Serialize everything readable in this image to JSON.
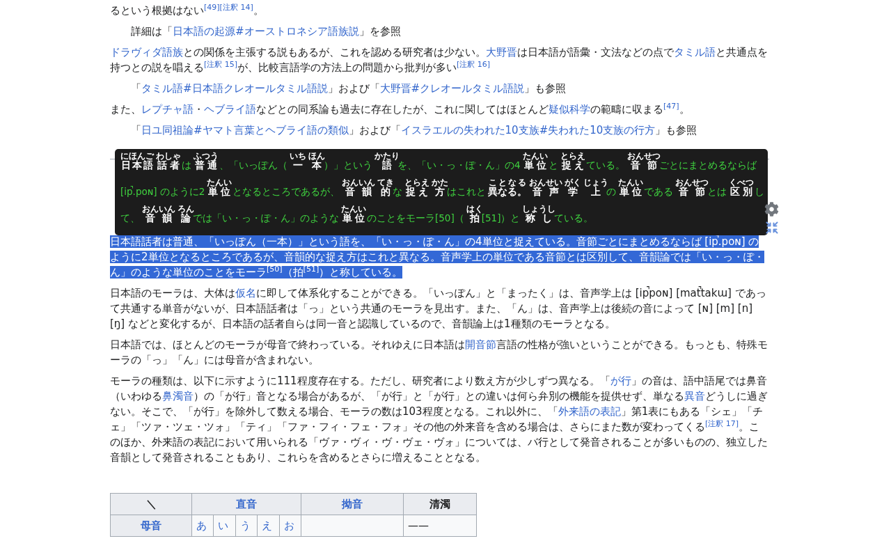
{
  "content": [
    {
      "kind": "paragraph",
      "segments": [
        {
          "kind": "text",
          "text": "るという根拠はない"
        },
        {
          "kind": "ref",
          "text": "[49]"
        },
        {
          "kind": "ref",
          "text": "[注釈 14]"
        },
        {
          "kind": "text",
          "text": "。"
        }
      ]
    },
    {
      "kind": "hatnote",
      "segments": [
        {
          "kind": "text",
          "text": "詳細は「"
        },
        {
          "kind": "link",
          "text": "日本語の起源#オーストロネシア語族説"
        },
        {
          "kind": "text",
          "text": "」を参照"
        }
      ]
    },
    {
      "kind": "paragraph",
      "segments": [
        {
          "kind": "link",
          "text": "ドラヴィダ語族"
        },
        {
          "kind": "text",
          "text": "との関係を主張する説もあるが、これを認める研究者は少ない。"
        },
        {
          "kind": "link",
          "text": "大野晋"
        },
        {
          "kind": "text",
          "text": "は日本語が語彙・文法などの点で"
        },
        {
          "kind": "link",
          "text": "タミル語"
        },
        {
          "kind": "text",
          "text": "と共通点を持つとの説を唱える"
        },
        {
          "kind": "ref",
          "text": "[注釈 15]"
        },
        {
          "kind": "text",
          "text": "が、比較言語学の方法上の問題から批判が多い"
        },
        {
          "kind": "ref",
          "text": "[注釈 16]"
        }
      ]
    },
    {
      "kind": "hatnote",
      "segments": [
        {
          "kind": "text",
          "text": "「"
        },
        {
          "kind": "link",
          "text": "タミル語#日本語クレオールタミル語説"
        },
        {
          "kind": "text",
          "text": "」および「"
        },
        {
          "kind": "link",
          "text": "大野晋#クレオールタミル語説"
        },
        {
          "kind": "text",
          "text": "」も参照"
        }
      ]
    },
    {
      "kind": "paragraph",
      "segments": [
        {
          "kind": "text",
          "text": "また、"
        },
        {
          "kind": "link",
          "text": "レプチャ語"
        },
        {
          "kind": "text",
          "text": "・"
        },
        {
          "kind": "link",
          "text": "ヘブライ語"
        },
        {
          "kind": "text",
          "text": "などとの同系論も過去に存在したが、これに関してはほとんど"
        },
        {
          "kind": "link",
          "text": "疑似科学"
        },
        {
          "kind": "text",
          "text": "の範疇に収まる"
        },
        {
          "kind": "ref",
          "text": "[47]"
        },
        {
          "kind": "text",
          "text": "。"
        }
      ]
    },
    {
      "kind": "hatnote",
      "segments": [
        {
          "kind": "text",
          "text": "「"
        },
        {
          "kind": "link",
          "text": "日ユ同祖論#ヤマト言葉とヘブライ語の類似"
        },
        {
          "kind": "text",
          "text": "」および「"
        },
        {
          "kind": "link",
          "text": "イスラエルの失われた10支族#失われた10支族の行方"
        },
        {
          "kind": "text",
          "text": "」も参照"
        }
      ]
    },
    {
      "kind": "gap"
    },
    {
      "kind": "paragraph",
      "selected": true,
      "segments": [
        {
          "kind": "text",
          "text": "日本語話者は普通、「いっぽん（一本）」という語を、「い・っ・ぽ・ん」の4単位と捉えている。音節ごとにまとめるならば [ip̚.poɴ] のように2単位となるところであるが、音韻的な捉え方はこれと異なる。音声学上の単位である音節とは区別して、音韻論では「い・っ・ぽ・ん」のような単位のことをモーラ"
        },
        {
          "kind": "ref",
          "text": "[50]"
        },
        {
          "kind": "text",
          "text": "（拍"
        },
        {
          "kind": "ref",
          "text": "[51]"
        },
        {
          "kind": "text",
          "text": "）と称している。"
        }
      ]
    },
    {
      "kind": "paragraph",
      "selected": false,
      "segments": [
        {
          "kind": "text",
          "text": "日本語のモーラは、大体は"
        },
        {
          "kind": "link",
          "text": "仮名"
        },
        {
          "kind": "text",
          "text": "に即して体系化することができる。「いっぽん」と「まったく」は、音声学上は [ip̚poɴ] [mat̚takɯ] であって共通する単音がないが、日本語話者は「っ」という共通のモーラを見出す。また、「ん」は、音声学上は後続の音によって [ɴ] [m] [n] [ŋ] などと変化するが、日本語の話者自らは同一音と認識しているので、音韻論上は1種類のモーラとなる。"
        }
      ]
    },
    {
      "kind": "paragraph",
      "segments": [
        {
          "kind": "text",
          "text": "日本語では、ほとんどのモーラが母音で終わっている。それゆえに日本語は"
        },
        {
          "kind": "link",
          "text": "開音節"
        },
        {
          "kind": "text",
          "text": "言語の性格が強いということができる。もっとも、特殊モーラの「っ」「ん」には母音が含まれない。"
        }
      ]
    },
    {
      "kind": "paragraph",
      "segments": [
        {
          "kind": "text",
          "text": "モーラの種類は、以下に示すように111程度存在する。ただし、研究者により数え方が少しずつ異なる。「"
        },
        {
          "kind": "link",
          "text": "が行"
        },
        {
          "kind": "text",
          "text": "」の音は、語中語尾では鼻音（いわゆる"
        },
        {
          "kind": "link",
          "text": "鼻濁音"
        },
        {
          "kind": "text",
          "text": "）の「が行」音となる場合があるが、「が行」と「が行」との違いは何ら弁別の機能を提供せず、単なる"
        },
        {
          "kind": "link",
          "text": "異音"
        },
        {
          "kind": "text",
          "text": "どうしに過ぎない。そこで、「が行」を除外して数える場合、モーラの数は103程度となる。これ以外に、「"
        },
        {
          "kind": "link",
          "text": "外来語の表記"
        },
        {
          "kind": "text",
          "text": "」第1表にもある「シェ」「チェ」「ツァ・ツェ・ツォ」「ティ」「ファ・フィ・フェ・フォ」その他の外来音を含める場合は、さらにまた数が変わってくる"
        },
        {
          "kind": "ref",
          "text": "[注釈 17]"
        },
        {
          "kind": "text",
          "text": "。このほか、外来語の表記において用いられる「ヴァ・ヴィ・ヴ・ヴェ・ヴォ」については、バ行として発音されることが多いものの、独立した音韻として発音されることもあり、これらを含めるとさらに増えることとなる。"
        }
      ]
    }
  ],
  "popup": {
    "segments": [
      {
        "kind": "kanji",
        "text": "日本語",
        "reading": "にほんご"
      },
      {
        "kind": "kanji",
        "text": "話者",
        "reading": "わしゃ"
      },
      {
        "kind": "kana",
        "text": "は"
      },
      {
        "kind": "kanji",
        "text": "普通",
        "reading": "ふつう"
      },
      {
        "kind": "kana",
        "text": "、「いっぽん（"
      },
      {
        "kind": "kanji",
        "text": "一",
        "reading": "いち"
      },
      {
        "kind": "kanji",
        "text": "本",
        "reading": "ほん"
      },
      {
        "kind": "kana",
        "text": "）」という"
      },
      {
        "kind": "kanji",
        "text": "語",
        "reading": "かたり"
      },
      {
        "kind": "kana",
        "text": "を、「い・っ・ぽ・ん」の4"
      },
      {
        "kind": "kanji",
        "text": "単位",
        "reading": "たんい"
      },
      {
        "kind": "kana",
        "text": "と"
      },
      {
        "kind": "kanji",
        "text": "捉え",
        "reading": "とらえ"
      },
      {
        "kind": "kana",
        "text": "ている。"
      },
      {
        "kind": "kanji",
        "text": "音節",
        "reading": "おんせつ"
      },
      {
        "kind": "kana",
        "text": "ごとにまとめるならば [ip̚.poɴ] のように2"
      },
      {
        "kind": "kanji",
        "text": "単位",
        "reading": "たんい"
      },
      {
        "kind": "kana",
        "text": "となるところであるが、"
      },
      {
        "kind": "kanji",
        "text": "音韻",
        "reading": "おんいん"
      },
      {
        "kind": "kanji",
        "text": "的",
        "reading": "てき"
      },
      {
        "kind": "kana",
        "text": "な"
      },
      {
        "kind": "kanji",
        "text": "捉え",
        "reading": "とらえ"
      },
      {
        "kind": "kanji",
        "text": "方",
        "reading": "かた"
      },
      {
        "kind": "kana",
        "text": "はこれと"
      },
      {
        "kind": "kanji",
        "text": "異なる。",
        "reading": "ことなる"
      },
      {
        "kind": "kanji",
        "text": "音声",
        "reading": "おんせい"
      },
      {
        "kind": "kanji",
        "text": "学",
        "reading": "がく"
      },
      {
        "kind": "kanji",
        "text": "上",
        "reading": "じょう"
      },
      {
        "kind": "kana",
        "text": "の"
      },
      {
        "kind": "kanji",
        "text": "単位",
        "reading": "たんい"
      },
      {
        "kind": "kana",
        "text": "である"
      },
      {
        "kind": "kanji",
        "text": "音節",
        "reading": "おんせつ"
      },
      {
        "kind": "kana",
        "text": "とは"
      },
      {
        "kind": "kanji",
        "text": "区別",
        "reading": "くべつ"
      },
      {
        "kind": "kana",
        "text": "して、"
      },
      {
        "kind": "kanji",
        "text": "音韻",
        "reading": "おんいん"
      },
      {
        "kind": "kanji",
        "text": "論",
        "reading": "ろん"
      },
      {
        "kind": "kana",
        "text": "では「い・っ・ぽ・ん」のような"
      },
      {
        "kind": "kanji",
        "text": "単位",
        "reading": "たんい"
      },
      {
        "kind": "kana",
        "text": "のことをモーラ[50]（"
      },
      {
        "kind": "kanji",
        "text": "拍",
        "reading": "はく"
      },
      {
        "kind": "kana",
        "text": "[51]）と"
      },
      {
        "kind": "kanji",
        "text": "称し",
        "reading": "しょうし"
      },
      {
        "kind": "kana",
        "text": "ている。"
      }
    ]
  },
  "table": {
    "header_cells": [
      {
        "label": "＼",
        "kind": "plain"
      },
      {
        "label": "直音",
        "kind": "link",
        "colspan": 5
      },
      {
        "label": "拗音",
        "kind": "link"
      },
      {
        "label": "清濁",
        "kind": "plain"
      }
    ],
    "rows": [
      {
        "label": "母音",
        "cells": [
          {
            "kind": "link",
            "text": "あ"
          },
          {
            "kind": "link",
            "text": "い"
          },
          {
            "kind": "link",
            "text": "う"
          },
          {
            "kind": "link",
            "text": "え"
          },
          {
            "kind": "link",
            "text": "お"
          },
          {
            "kind": "empty"
          },
          {
            "kind": "text",
            "text": "——"
          }
        ]
      }
    ]
  }
}
